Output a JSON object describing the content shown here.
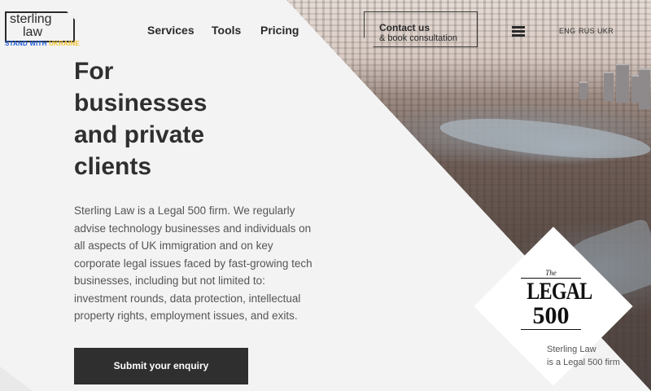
{
  "logo": {
    "line1": "sterling",
    "line2": "law",
    "stand_with": "STAND WITH",
    "ukraine": "UKRAINE"
  },
  "nav": {
    "items": [
      {
        "label": "Services"
      },
      {
        "label": "Tools"
      },
      {
        "label": "Pricing"
      }
    ]
  },
  "contact": {
    "title": "Contact us",
    "subtitle": "& book consultation"
  },
  "languages": [
    "ENG",
    "RUS",
    "UKR"
  ],
  "hero": {
    "headline_lines": [
      "For",
      "businesses",
      "and private",
      "clients"
    ],
    "body": "Sterling Law is a Legal 500 firm. We regularly advise technology businesses and individuals on all aspects of UK immigration and on key corporate legal issues faced by fast-growing tech businesses, including but not limited to: investment rounds, data protection, intellectual property rights, employment issues, and exits.",
    "cta": "Submit your enquiry"
  },
  "legal500": {
    "the": "The",
    "legal": "LEGAL",
    "number": "500",
    "caption_line1": "Sterling Law",
    "caption_line2": "is a Legal 500 firm"
  },
  "colors": {
    "text_dark": "#2a2a2a",
    "button_bg": "#2f2f2f",
    "ukraine_blue": "#1f5bd6",
    "ukraine_yellow": "#f2c12e",
    "page_bg": "#f3f3f3"
  }
}
